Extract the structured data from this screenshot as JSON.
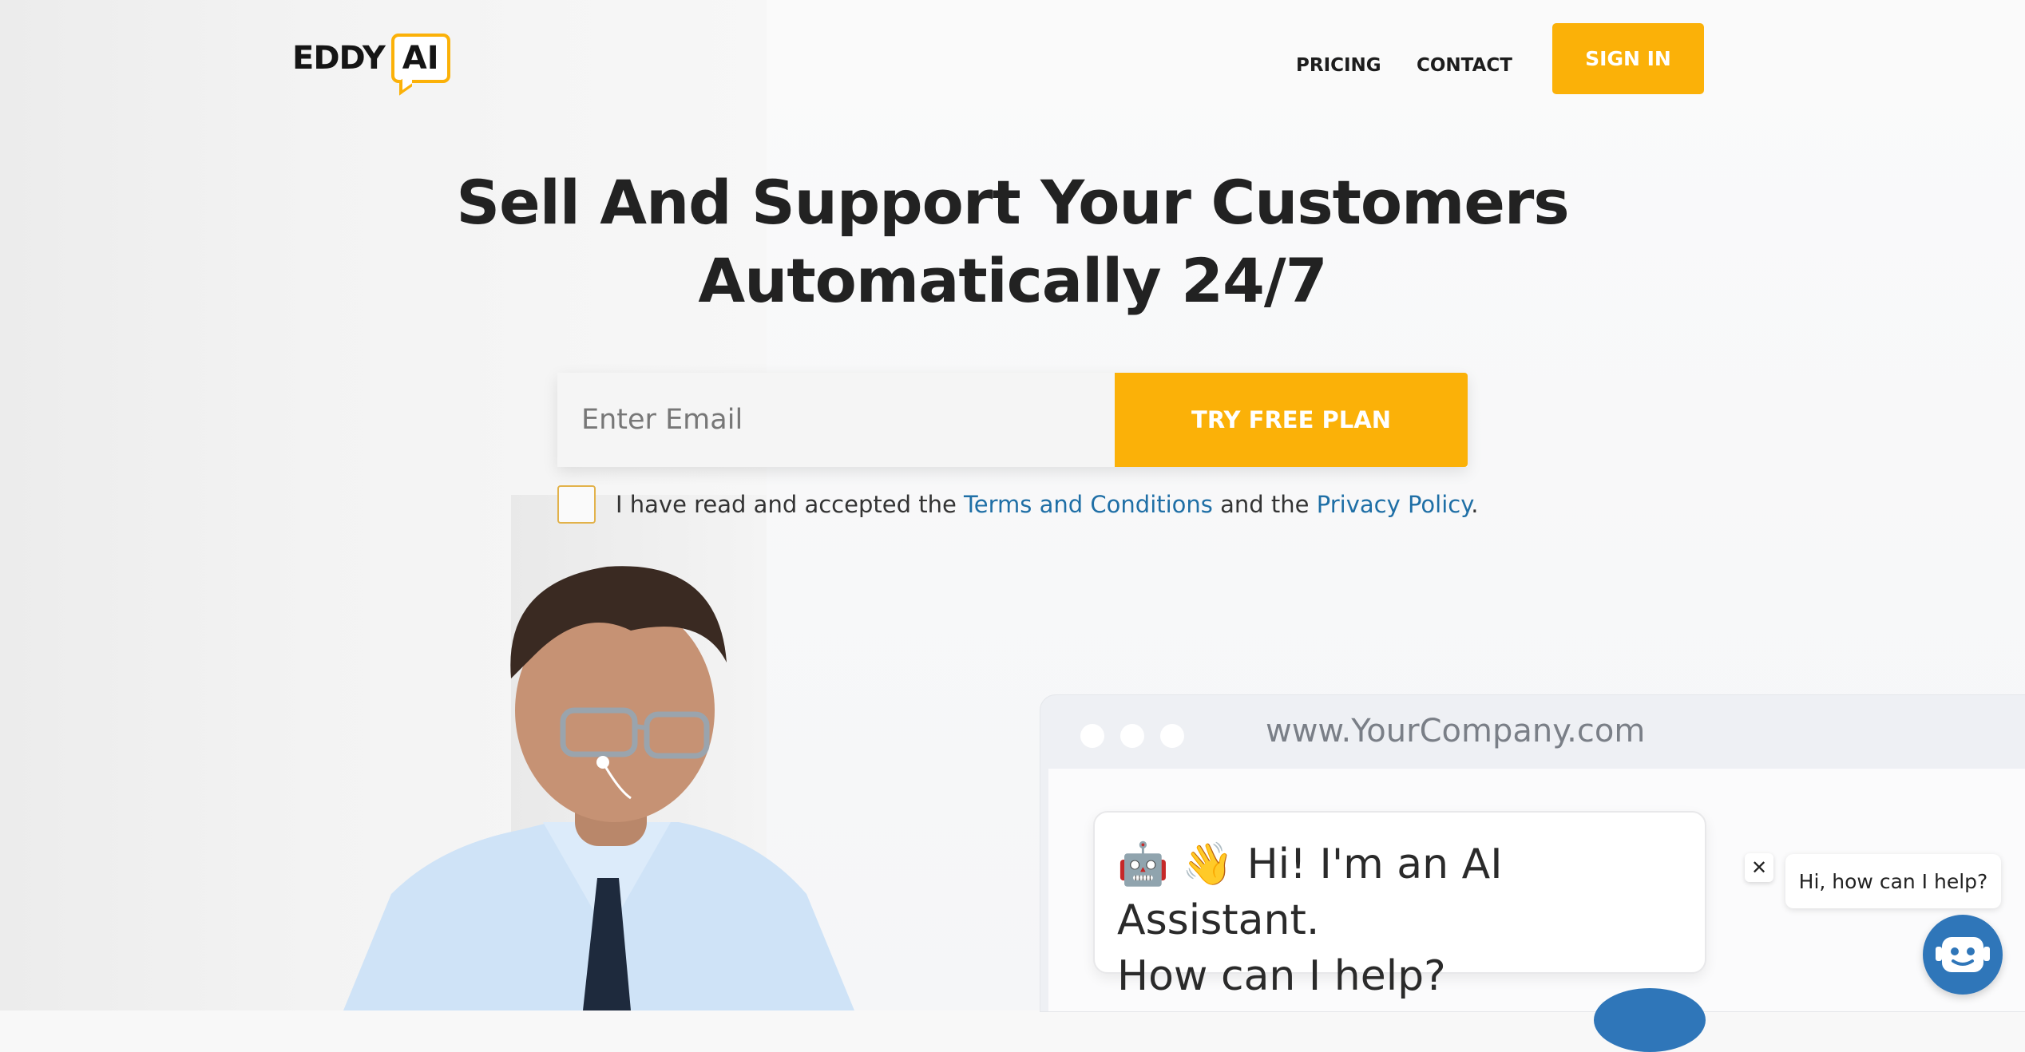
{
  "header": {
    "logo_text": "EDDY",
    "logo_box": "AI",
    "nav": {
      "pricing": "PRICING",
      "contact": "CONTACT"
    },
    "signin_label": "SIGN IN"
  },
  "hero": {
    "headline_line1": "Sell And Support Your Customers",
    "headline_line2": "Automatically 24/7",
    "email_placeholder": "Enter Email",
    "cta_label": "TRY FREE PLAN",
    "consent": {
      "prefix": "I have read and accepted the ",
      "terms_link": "Terms and Conditions",
      "middle": " and the ",
      "privacy_link": "Privacy Policy",
      "suffix": "."
    }
  },
  "mockup": {
    "url": "www.YourCompany.com",
    "bubble_emoji": "🤖 👋",
    "bubble_line1": "Hi! I'm an AI Assistant.",
    "bubble_line2": "How can I help?"
  },
  "widget": {
    "close": "✕",
    "tip": "Hi, how can I help?"
  },
  "colors": {
    "accent": "#fbb108",
    "link": "#1f6fa6",
    "heading": "#222222",
    "widget_blue": "#2f76b9"
  }
}
